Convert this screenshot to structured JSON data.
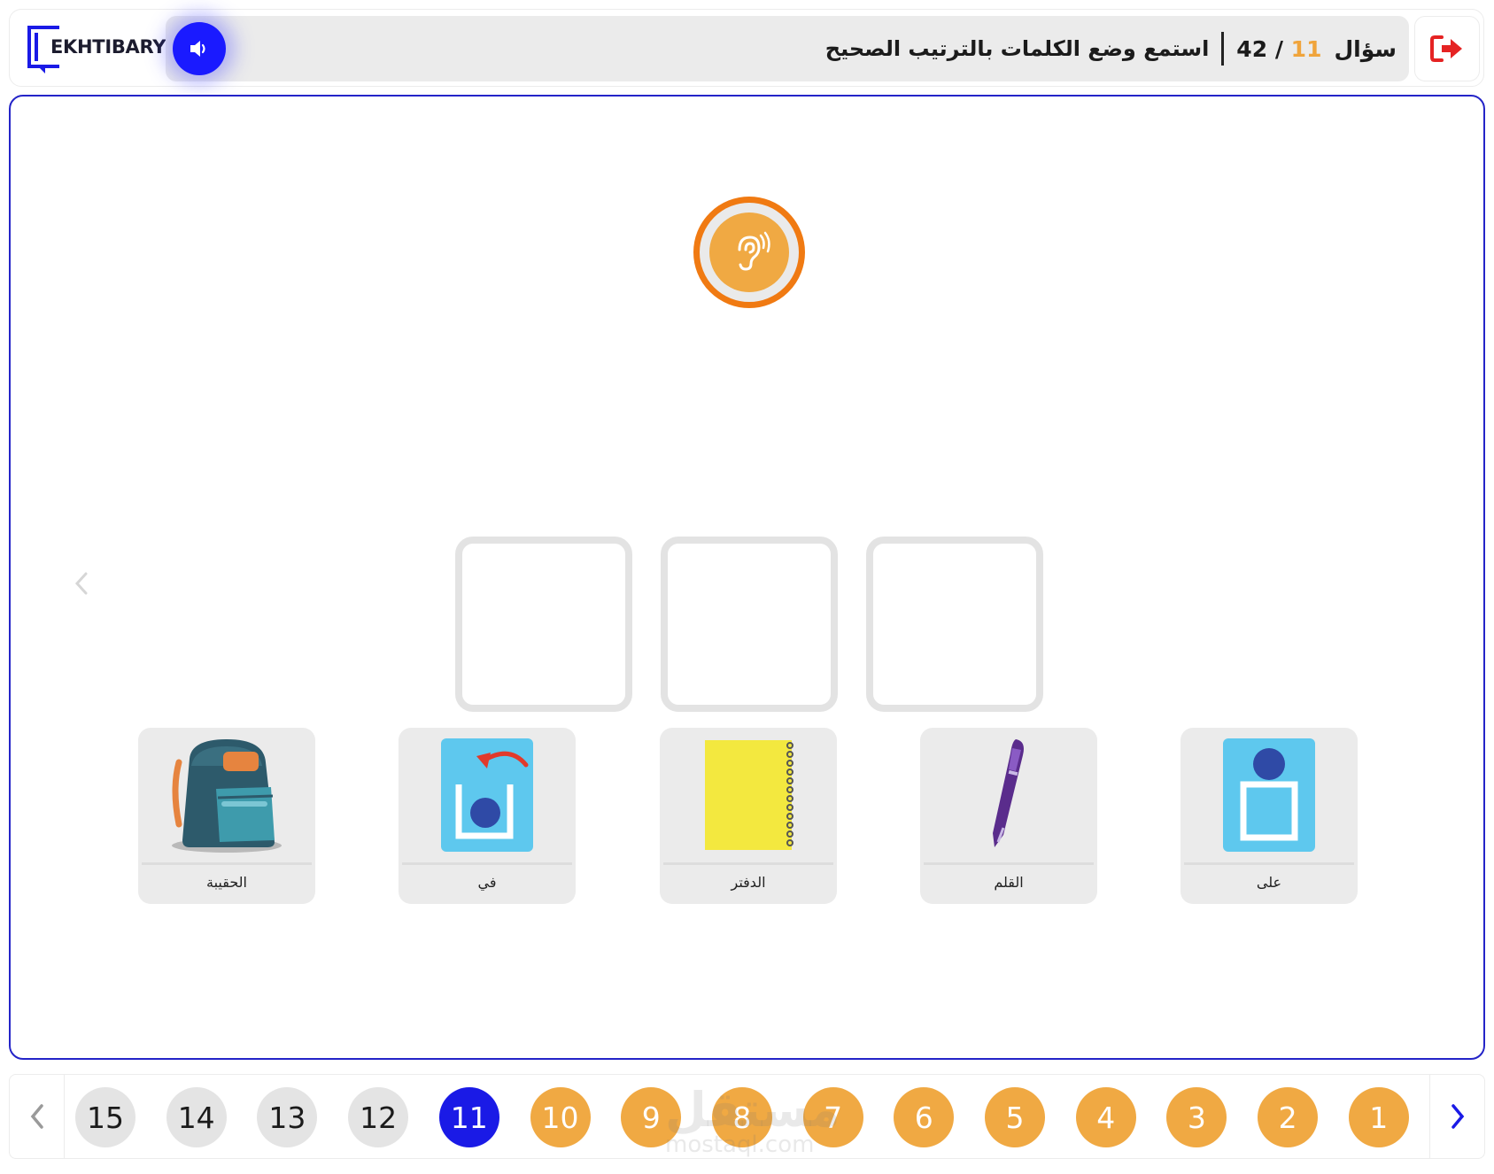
{
  "brand": {
    "logo_text": "EKHTIBARY"
  },
  "header": {
    "question_label": "سؤال",
    "question_current": "11",
    "question_total": "42",
    "count_separator": "/",
    "instruction": "استمع وضع الكلمات بالترتيب الصحيح"
  },
  "icons": {
    "sound": "speaker-icon",
    "exit": "exit-icon",
    "listen": "ear-icon",
    "prev": "chevron-left-icon",
    "next": "chevron-right-icon"
  },
  "colors": {
    "accent": "#1a1aff",
    "done": "#f0a943",
    "ear_ring": "#f07a12",
    "exit": "#e52323"
  },
  "answer_slots": 3,
  "cards": [
    {
      "label": "الحقيبة",
      "icon": "backpack-icon"
    },
    {
      "label": "في",
      "icon": "in-preposition-icon"
    },
    {
      "label": "الدفتر",
      "icon": "notebook-icon"
    },
    {
      "label": "القلم",
      "icon": "pen-icon"
    },
    {
      "label": "على",
      "icon": "on-preposition-icon"
    }
  ],
  "pagination": {
    "pages": [
      {
        "label": "15",
        "state": "todo"
      },
      {
        "label": "14",
        "state": "todo"
      },
      {
        "label": "13",
        "state": "todo"
      },
      {
        "label": "12",
        "state": "todo"
      },
      {
        "label": "11",
        "state": "current"
      },
      {
        "label": "10",
        "state": "done"
      },
      {
        "label": "9",
        "state": "done"
      },
      {
        "label": "8",
        "state": "done"
      },
      {
        "label": "7",
        "state": "done"
      },
      {
        "label": "6",
        "state": "done"
      },
      {
        "label": "5",
        "state": "done"
      },
      {
        "label": "4",
        "state": "done"
      },
      {
        "label": "3",
        "state": "done"
      },
      {
        "label": "2",
        "state": "done"
      },
      {
        "label": "1",
        "state": "done"
      }
    ]
  },
  "watermark": {
    "text": "مستقل",
    "sub": "mostaql.com"
  }
}
